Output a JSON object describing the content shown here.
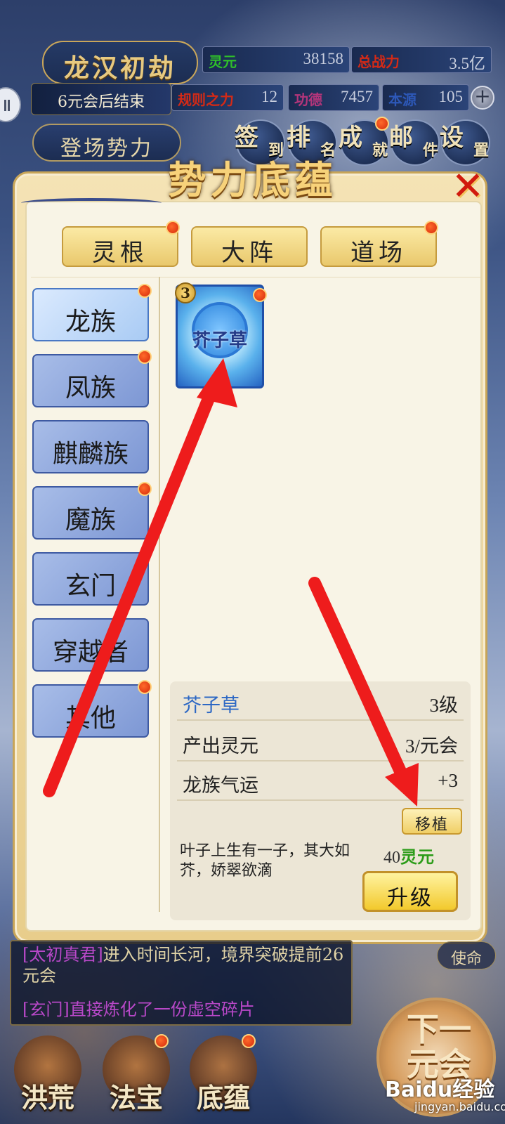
{
  "hud": {
    "stage_title": "龙汉初劫",
    "timer_text": "6元会后结束",
    "stats_row1": [
      {
        "label": "灵元",
        "value": "38158",
        "color": "#2fbf2a"
      },
      {
        "label": "总战力",
        "value": "3.5亿",
        "color": "#d42a16"
      }
    ],
    "stats_row2": [
      {
        "label": "规则之力",
        "value": "12",
        "color": "#d42a16"
      },
      {
        "label": "功德",
        "value": "7457",
        "color": "#b3357a"
      },
      {
        "label": "本源",
        "value": "105",
        "color": "#2d58b8"
      }
    ],
    "plus": "+",
    "realm_label": "登场势力",
    "top_buttons": [
      {
        "big": "签",
        "small": "到"
      },
      {
        "big": "排",
        "small": "名"
      },
      {
        "big": "成",
        "small": "就"
      },
      {
        "big": "邮",
        "small": "件"
      },
      {
        "big": "设",
        "small": "置"
      }
    ]
  },
  "modal": {
    "title": "势力底蕴",
    "close": "✕",
    "tabs": [
      "灵根",
      "大阵",
      "道场"
    ],
    "categories": [
      "龙族",
      "凤族",
      "麒麟族",
      "魔族",
      "玄门",
      "穿越者",
      "其他"
    ],
    "item": {
      "name": "芥子草",
      "level": "3"
    },
    "detail": {
      "name": "芥子草",
      "level": "3级",
      "output_label": "产出灵元",
      "output_value": "3/元会",
      "fortune_label": "龙族气运",
      "fortune_value": "+3",
      "transplant": "移植",
      "description": "叶子上生有一子，其大如芥，娇翠欲滴",
      "cost_value": "40",
      "cost_unit": "灵元",
      "upgrade": "升级"
    }
  },
  "log": {
    "line1_tag": "[太初真君]",
    "line1_text": "进入时间长河，境界突破提前26元会",
    "line2": "[玄门]直接炼化了一份虚空碎片",
    "missions": "使命"
  },
  "bottom_nav": [
    "洪荒",
    "法宝",
    "底蕴"
  ],
  "next_button": "下一元会",
  "watermark": {
    "brand": "Baidu经验",
    "url": "jingyan.baidu.com"
  },
  "colors": {
    "red_dot": "#e2340f",
    "arrow": "#ee1c1c",
    "gold_accent": "#e9c86c",
    "category_blue": "#8aa4dc"
  }
}
